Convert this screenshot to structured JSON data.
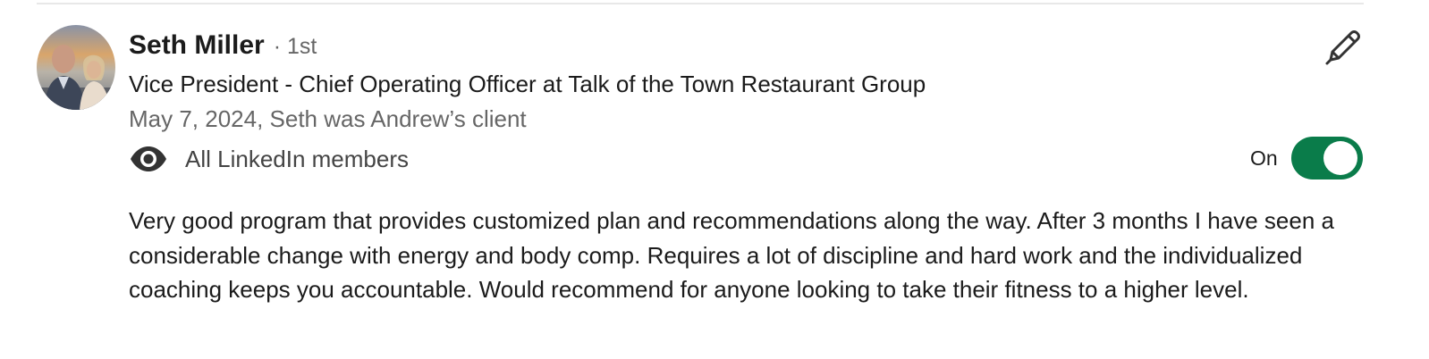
{
  "recommendation": {
    "author": {
      "name": "Seth Miller",
      "degree": "· 1st",
      "headline": "Vice President - Chief Operating Officer at Talk of the Town Restaurant Group"
    },
    "meta": "May 7, 2024, Seth was Andrew’s client",
    "visibility": {
      "icon": "eye-icon",
      "label": "All LinkedIn members"
    },
    "toggle": {
      "label": "On",
      "state": true,
      "color": "#0a7c4a"
    },
    "edit_icon": "pencil-icon",
    "text": "Very good program that provides customized plan and recommendations along the way. After 3 months I have seen a considerable change with energy and body comp. Requires a lot of discipline and hard work and the individualized coaching keeps you accountable. Would recommend for anyone looking to take their fitness to a higher level."
  }
}
